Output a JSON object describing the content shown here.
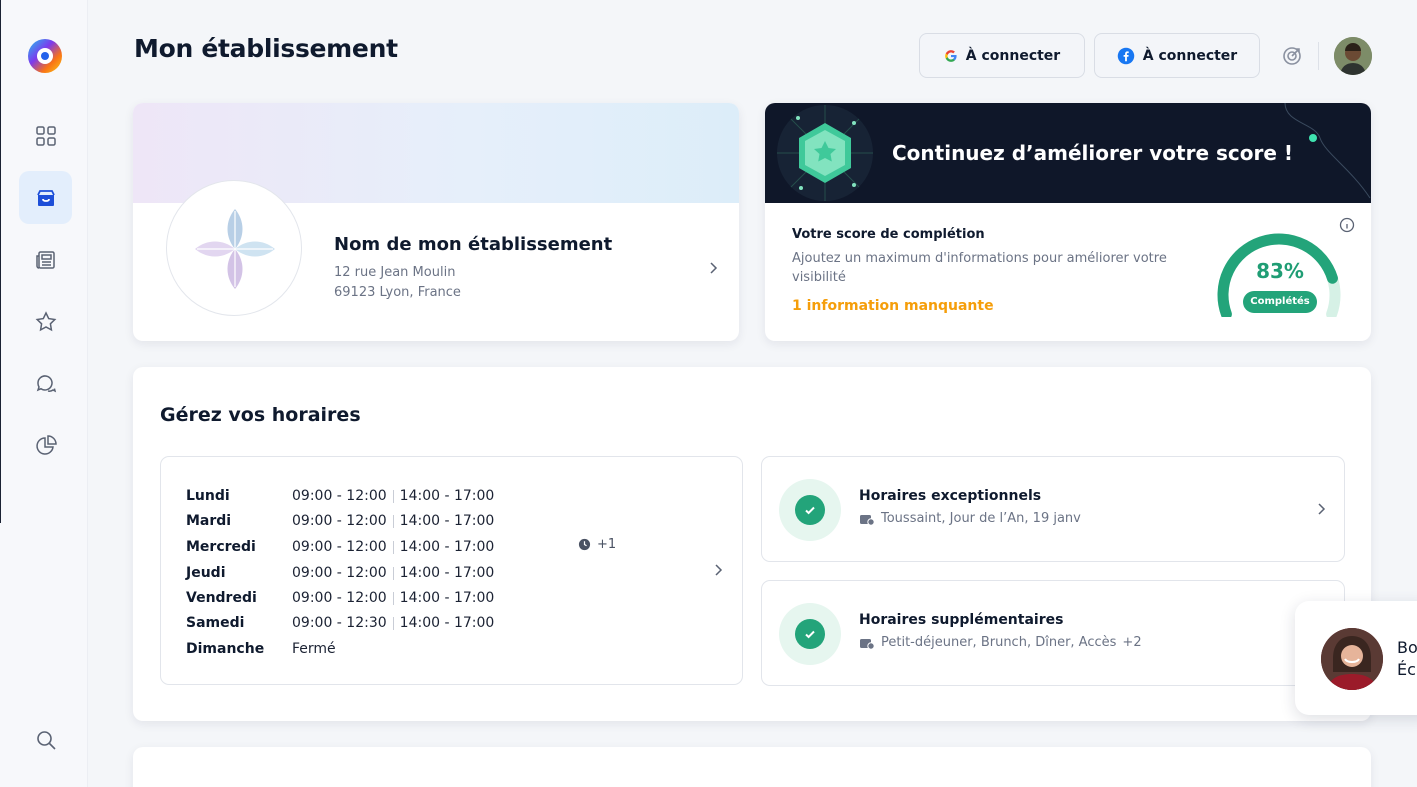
{
  "header": {
    "title": "Mon établissement",
    "google_button": "À connecter",
    "facebook_button": "À connecter"
  },
  "sidebar": {
    "items": [
      {
        "name": "dashboard"
      },
      {
        "name": "store",
        "active": true
      },
      {
        "name": "posts"
      },
      {
        "name": "reviews"
      },
      {
        "name": "messages"
      },
      {
        "name": "insights"
      }
    ],
    "search": "search"
  },
  "business": {
    "name": "Nom de mon établissement",
    "address_line1": "12 rue Jean Moulin",
    "address_line2": "69123 Lyon, France"
  },
  "score": {
    "banner_title": "Continuez d’améliorer votre score !",
    "label": "Votre score de complétion",
    "description": "Ajoutez un maximum d'informations pour améliorer votre visibilité",
    "missing": "1 information manquante",
    "percent_text": "83%",
    "percent_value": 83,
    "badge": "Complétés"
  },
  "hours": {
    "title": "Gérez vos horaires",
    "days": [
      {
        "day": "Lundi",
        "slot1": "09:00 - 12:00",
        "slot2": "14:00 - 17:00"
      },
      {
        "day": "Mardi",
        "slot1": "09:00 - 12:00",
        "slot2": "14:00 - 17:00"
      },
      {
        "day": "Mercredi",
        "slot1": "09:00 - 12:00",
        "slot2": "14:00 - 17:00"
      },
      {
        "day": "Jeudi",
        "slot1": "09:00 - 12:00",
        "slot2": "14:00 - 17:00"
      },
      {
        "day": "Vendredi",
        "slot1": "09:00 - 12:00",
        "slot2": "14:00 - 17:00"
      },
      {
        "day": "Samedi",
        "slot1": "09:00 - 12:30",
        "slot2": "14:00 - 17:00"
      },
      {
        "day": "Dimanche",
        "slot1": "Fermé",
        "slot2": ""
      }
    ],
    "extra_badge": "+1",
    "exceptional": {
      "title": "Horaires exceptionnels",
      "subtitle": "Toussaint, Jour de l’An, 19 janv"
    },
    "supplementary": {
      "title": "Horaires supplémentaires",
      "subtitle": "Petit-déjeuner, Brunch, Dîner, Accès",
      "more": "+2"
    }
  },
  "chat": {
    "line1": "Bo",
    "line2": "Éc"
  },
  "colors": {
    "accent_green": "#23a47a",
    "missing_orange": "#f59e0b",
    "dark_banner": "#0f1729"
  }
}
